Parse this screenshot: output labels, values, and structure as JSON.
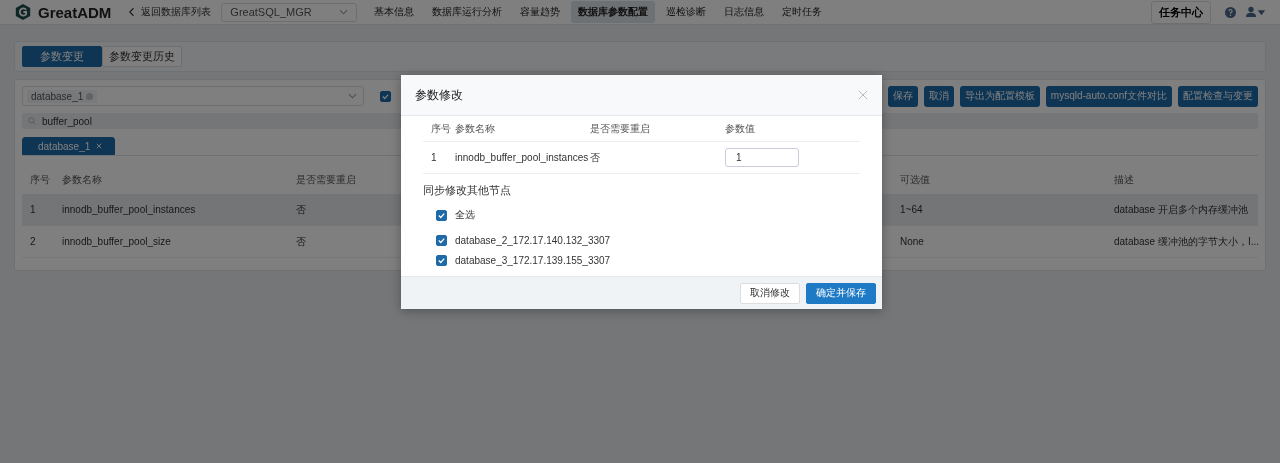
{
  "header": {
    "logo_text": "GreatADM",
    "back_link": "返回数据库列表",
    "cluster_select": "GreatSQL_MGR",
    "nav": [
      {
        "label": "基本信息",
        "selected": false
      },
      {
        "label": "数据库运行分析",
        "selected": false
      },
      {
        "label": "容量趋势",
        "selected": false
      },
      {
        "label": "数据库参数配置",
        "selected": true
      },
      {
        "label": "巡检诊断",
        "selected": false
      },
      {
        "label": "日志信息",
        "selected": false
      },
      {
        "label": "定时任务",
        "selected": false
      }
    ],
    "task_center": "任务中心"
  },
  "page_tabs": [
    {
      "label": "参数变更",
      "selected": true
    },
    {
      "label": "参数变更历史",
      "selected": false
    }
  ],
  "toolbar": {
    "instance_tag": "database_1",
    "checkbox_checked": true,
    "buttons": [
      "保存",
      "取消",
      "导出为配置模板",
      "mysqld-auto.conf文件对比",
      "配置检查与变更"
    ]
  },
  "search": {
    "value": "buffer_pool"
  },
  "instance_tabs": [
    {
      "label": "database_1",
      "selected": true
    }
  ],
  "table": {
    "columns": [
      "序号",
      "参数名称",
      "是否需要重启",
      "可选值",
      "描述"
    ],
    "rows": [
      {
        "cells": [
          "1",
          "innodb_buffer_pool_instances",
          "否",
          "1~64",
          "database 开启多个内存缓冲池"
        ],
        "selected": true
      },
      {
        "cells": [
          "2",
          "innodb_buffer_pool_size",
          "否",
          "None",
          "database 缓冲池的字节大小，I..."
        ],
        "selected": false
      }
    ]
  },
  "dialog": {
    "title": "参数修改",
    "columns": [
      "序号",
      "参数名称",
      "是否需要重启",
      "参数值"
    ],
    "row": {
      "cells": [
        "1",
        "innodb_buffer_pool_instances",
        "否"
      ],
      "value": "1"
    },
    "sync_title": "同步修改其他节点",
    "nodes": [
      {
        "label": "全选",
        "checked": true
      },
      {
        "label": "database_2_172.17.140.132_3307",
        "checked": true
      },
      {
        "label": "database_3_172.17.139.155_3307",
        "checked": true
      }
    ],
    "buttons": [
      {
        "label": "取消修改",
        "kind": "plain"
      },
      {
        "label": "确定并保存",
        "kind": "primary"
      }
    ]
  }
}
